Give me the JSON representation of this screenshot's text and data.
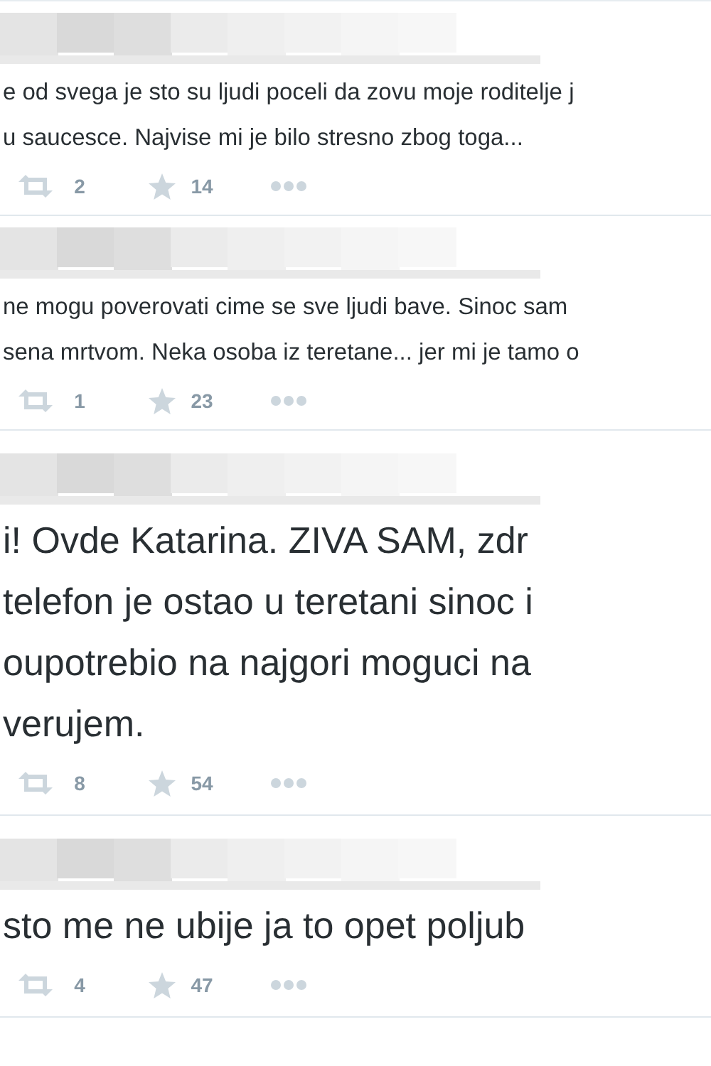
{
  "tweets": [
    {
      "kind": "normal",
      "lines": [
        "e od svega je sto su ljudi poceli da zovu moje roditelje j",
        "u saucesce. Najvise mi je bilo stresno zbog toga..."
      ],
      "retweets": "2",
      "favorites": "14"
    },
    {
      "kind": "normal",
      "lines": [
        "ne mogu poverovati cime se sve ljudi bave. Sinoc sam",
        "sena mrtvom. Neka osoba iz teretane... jer mi je tamo o"
      ],
      "retweets": "1",
      "favorites": "23"
    },
    {
      "kind": "large",
      "lines": [
        "i! Ovde Katarina. ZIVA SAM, zdr",
        "telefon je ostao u teretani sinoc i",
        "oupotrebio na najgori moguci na",
        "verujem."
      ],
      "retweets": "8",
      "favorites": "54"
    },
    {
      "kind": "large",
      "lines": [
        "sto me ne ubije ja to opet poljub"
      ],
      "retweets": "4",
      "favorites": "47"
    }
  ]
}
